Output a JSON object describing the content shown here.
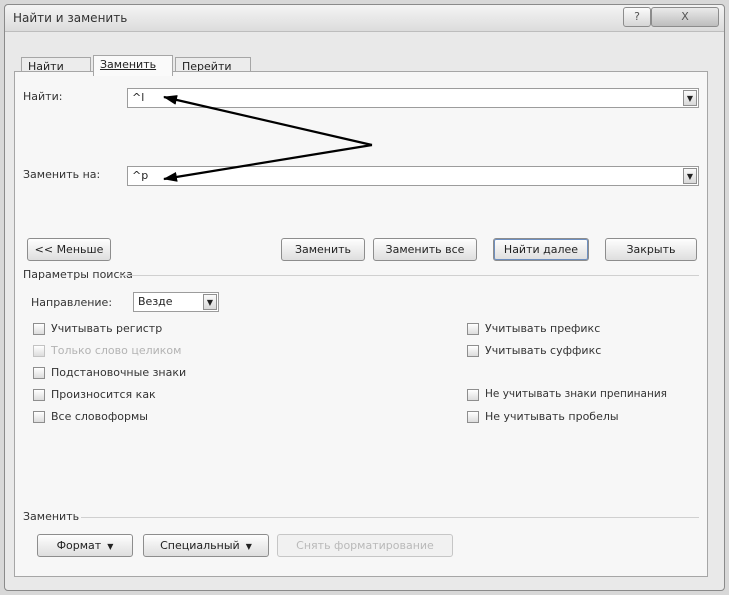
{
  "window": {
    "title": "Найти и заменить",
    "help_label": "?",
    "close_label": "X"
  },
  "tabs": [
    {
      "label": "Найти"
    },
    {
      "label": "Заменить"
    },
    {
      "label": "Перейти"
    }
  ],
  "find": {
    "label": "Найти:",
    "value": "^l"
  },
  "replace": {
    "label": "Заменить на:",
    "value": "^p"
  },
  "buttons": {
    "less": "<< Меньше",
    "replace": "Заменить",
    "replace_all": "Заменить все",
    "find_next": "Найти далее",
    "close": "Закрыть"
  },
  "search_params": {
    "title": "Параметры поиска",
    "direction_label": "Направление:",
    "direction_value": "Везде",
    "options_left": [
      {
        "label": "Учитывать регистр",
        "enabled": true
      },
      {
        "label": "Только слово целиком",
        "enabled": false
      },
      {
        "label": "Подстановочные знаки",
        "enabled": true
      },
      {
        "label": "Произносится как",
        "enabled": true
      },
      {
        "label": "Все словоформы",
        "enabled": true
      }
    ],
    "options_right": [
      {
        "label": "Учитывать префикс",
        "enabled": true
      },
      {
        "label": "Учитывать суффикс",
        "enabled": true
      },
      {
        "label": "Не учитывать знаки препинания",
        "enabled": true
      },
      {
        "label": "Не учитывать пробелы",
        "enabled": true
      }
    ]
  },
  "replace_section": {
    "title": "Заменить",
    "format_label": "Формат",
    "special_label": "Специальный",
    "clear_format_label": "Снять форматирование"
  },
  "colors": {
    "arrow": "#000000",
    "panel_bg": "#f7f7f7",
    "window_bg": "#e9e9e9"
  }
}
